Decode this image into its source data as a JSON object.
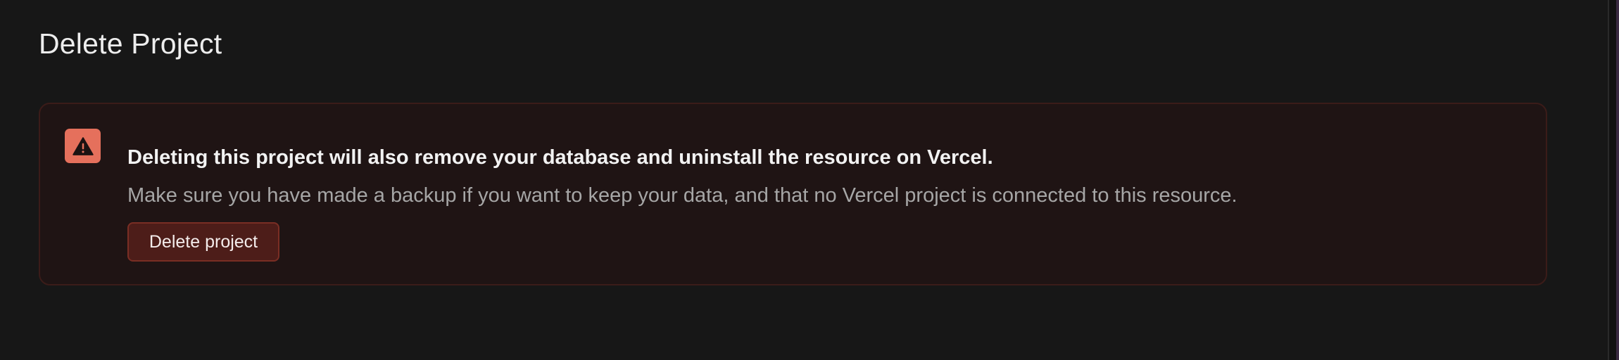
{
  "section": {
    "title": "Delete Project"
  },
  "alert": {
    "icon": "warning-triangle-icon",
    "heading": "Deleting this project will also remove your database and uninstall the resource on Vercel.",
    "body": "Make sure you have made a backup if you want to keep your data, and that no Vercel project is connected to this resource.",
    "button_label": "Delete project"
  },
  "colors": {
    "background": "#171717",
    "alert_background": "#1f1414",
    "alert_border": "#3b1c19",
    "icon_background": "#e5705c",
    "button_background": "#4d1d19",
    "button_border": "#7a2e24"
  }
}
